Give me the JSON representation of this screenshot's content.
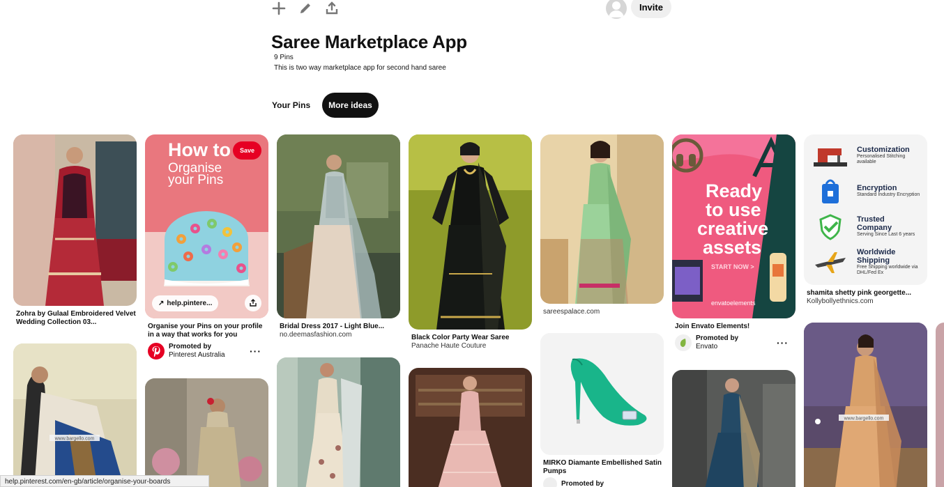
{
  "toolbar": {
    "icons": [
      "plus-icon",
      "pencil-icon",
      "share-icon"
    ]
  },
  "header": {
    "invite_label": "Invite"
  },
  "board": {
    "title": "Saree Marketplace App",
    "pin_count": "9 Pins",
    "description": "This is two way marketplace app for second hand saree"
  },
  "tabs": [
    {
      "label": "Your Pins",
      "active": false
    },
    {
      "label": "More ideas",
      "active": true
    }
  ],
  "pins": {
    "p1": {
      "title": "Zohra by Gulaal Embroidered Velvet Wedding Collection 03..."
    },
    "p2": {
      "save": "Save",
      "headline_1": "How to",
      "headline_2": "Organise",
      "headline_3": "your Pins",
      "link": "help.pintere...",
      "title": "Organise your Pins on your profile in a way that works for you",
      "promoted": "Promoted by",
      "advertiser": "Pinterest Australia"
    },
    "p3": {
      "title": "Bridal Dress 2017 - Light Blue...",
      "source": "no.deemasfashion.com"
    },
    "p4": {
      "title": "Black Color Party Wear Saree",
      "source": "Panache Haute Couture"
    },
    "p5": {
      "source": "sareespalace.com"
    },
    "p6": {
      "ad_line_1": "Ready",
      "ad_line_2": "to use",
      "ad_line_3": "creative",
      "ad_line_4": "assets",
      "ad_cta": "START NOW >",
      "ad_brand": "envatoelements",
      "title": "Join Envato Elements!",
      "promoted": "Promoted by",
      "advertiser": "Envato"
    },
    "p7": {
      "features": [
        {
          "title": "Customization",
          "sub": "Personalised Stitching available",
          "icon": "sewing-machine-icon"
        },
        {
          "title": "Encryption",
          "sub": "Standard Industry Encryption",
          "icon": "bag-lock-icon"
        },
        {
          "title": "Trusted Company",
          "sub": "Serving Since Last 6 years",
          "icon": "shield-check-icon"
        },
        {
          "title": "Worldwide Shipping",
          "sub": "Free Shipping worldwide via DHL/Fed Ex",
          "icon": "airplane-icon"
        }
      ],
      "title": "shamita shetty pink georgette...",
      "source": "Kollybollyethnics.com"
    },
    "p8": {
      "watermark": "www.bargello.com"
    },
    "p11": {
      "title": "MIRKO Diamante Embellished Satin Pumps",
      "promoted": "Promoted by"
    },
    "p13": {
      "watermark": "www.bargello.com"
    }
  },
  "status_bar": {
    "url": "help.pinterest.com/en-gb/article/organise-your-boards"
  },
  "colors": {
    "accent": "#e60023",
    "tab_active": "#111111",
    "envato_green": "#82b541"
  }
}
